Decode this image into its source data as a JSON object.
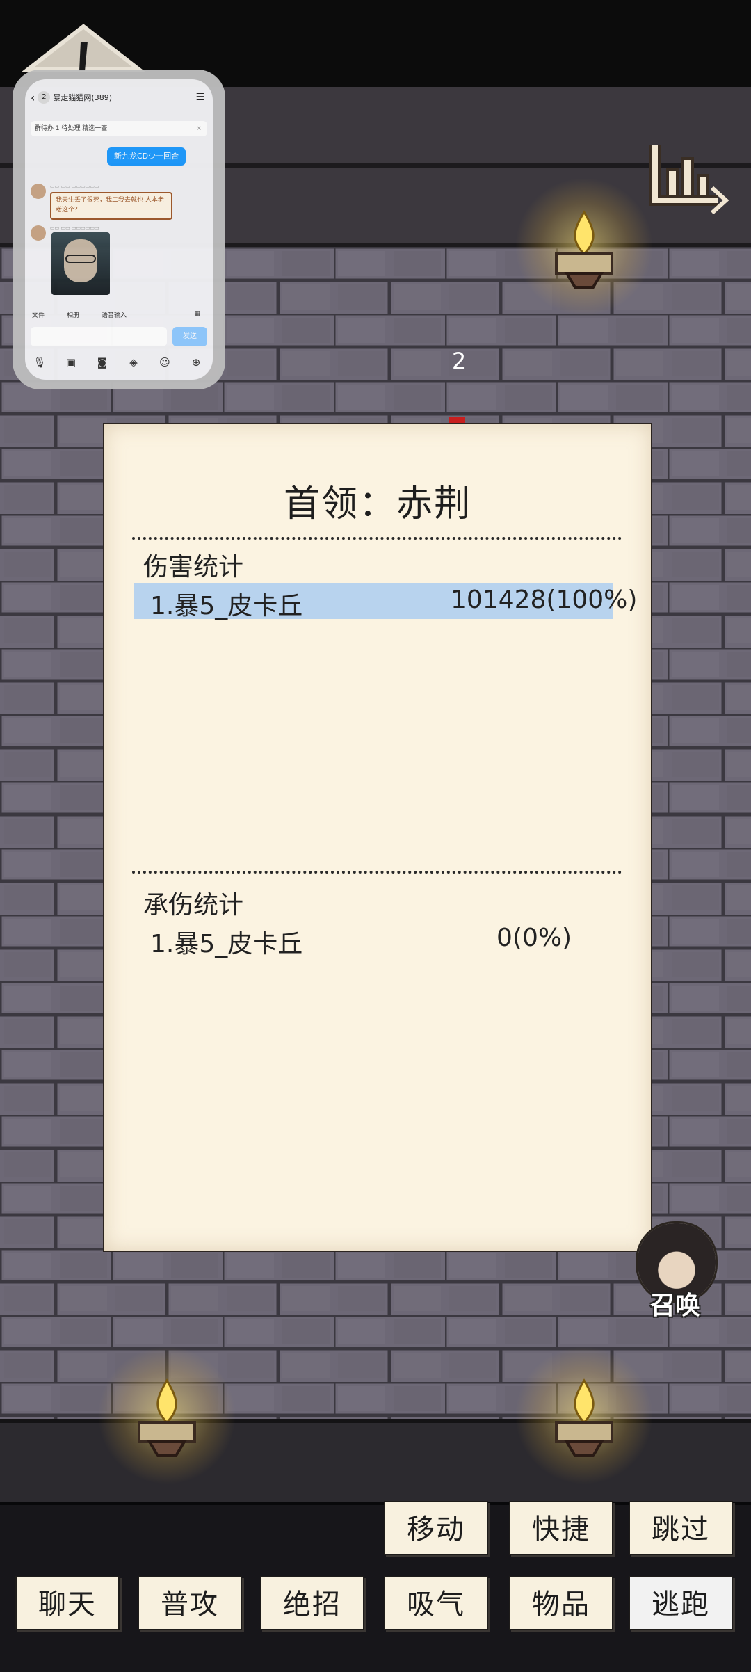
{
  "chat": {
    "back_icon": "back-chevron-icon",
    "unread_count": "2",
    "group_title": "暴走猫猫网(389)",
    "notice_text": "群待办 1 待处理 精选一查",
    "my_bubble": "新九龙CD少一回合",
    "sticker_text": "我天生丢了很死，我二我去就也 人本老老这个？",
    "send_label": "发送",
    "tools": [
      "文件",
      "相册",
      "语音输入"
    ]
  },
  "game": {
    "turn_number": "2",
    "boss_title": "首领：赤荆",
    "damage_section": "伤害统计",
    "damage_rows": [
      {
        "name": "1.暴5_皮卡丘",
        "value": "101428(100%)"
      }
    ],
    "taken_section": "承伤统计",
    "taken_rows": [
      {
        "name": "1.暴5_皮卡丘",
        "value": "0(0%)"
      }
    ],
    "summon_label": "召唤"
  },
  "buttons": {
    "move": "移动",
    "shortcut": "快捷",
    "skip": "跳过",
    "chat": "聊天",
    "attack": "普攻",
    "ultimate": "绝招",
    "breathe": "吸气",
    "items": "物品",
    "flee": "逃跑"
  },
  "colors": {
    "panel_bg": "#fbf3e1",
    "highlight_row": "#b8d3ee",
    "brick": "#6d6876",
    "chat_send": "#1e9bff"
  }
}
